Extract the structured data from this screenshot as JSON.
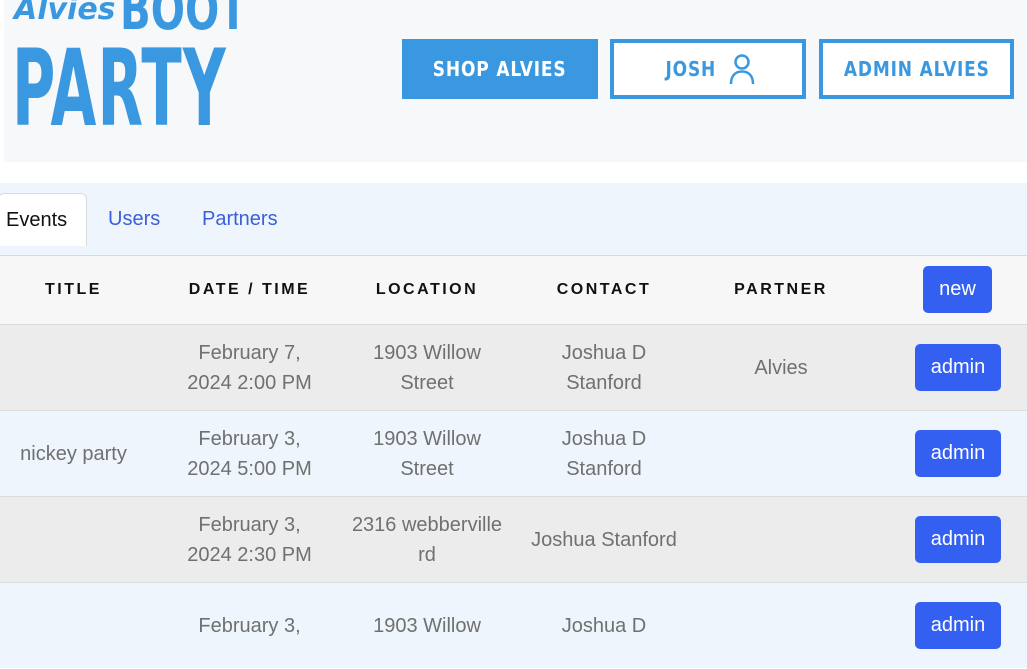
{
  "logo": {
    "script_word": "Alvies",
    "word_top": "BOOT",
    "word_bottom": "PARTY"
  },
  "header": {
    "shop_button": "Shop Alvies",
    "user_button": "Josh",
    "admin_button": "Admin Alvies",
    "user_icon": "user-icon"
  },
  "tabs": [
    {
      "label": "Events",
      "active": true
    },
    {
      "label": "Users",
      "active": false
    },
    {
      "label": "Partners",
      "active": false
    }
  ],
  "table": {
    "columns": [
      "TITLE",
      "DATE / TIME",
      "LOCATION",
      "CONTACT",
      "PARTNER"
    ],
    "new_button": "new",
    "rows": [
      {
        "title": "",
        "date_line1": "February 7,",
        "date_line2": "2024 2:00 PM",
        "location_line1": "1903 Willow",
        "location_line2": "Street",
        "contact_line1": "Joshua D",
        "contact_line2": "Stanford",
        "partner": "Alvies",
        "action": "admin"
      },
      {
        "title": "nickey party",
        "date_line1": "February 3,",
        "date_line2": "2024 5:00 PM",
        "location_line1": "1903 Willow",
        "location_line2": "Street",
        "contact_line1": "Joshua D",
        "contact_line2": "Stanford",
        "partner": "",
        "action": "admin"
      },
      {
        "title": "",
        "date_line1": "February 3,",
        "date_line2": "2024 2:30 PM",
        "location_line1": "2316 webberville",
        "location_line2": "rd",
        "contact_line1": "Joshua Stanford",
        "contact_line2": "",
        "partner": "",
        "action": "admin"
      },
      {
        "title": "",
        "date_line1": "February 3,",
        "date_line2": "",
        "location_line1": "1903 Willow",
        "location_line2": "",
        "contact_line1": "Joshua D",
        "contact_line2": "",
        "partner": "",
        "action": "admin"
      }
    ]
  },
  "colors": {
    "brand_blue": "#3a98e0",
    "button_blue": "#3360f0",
    "link_blue": "#3b5fd9"
  }
}
